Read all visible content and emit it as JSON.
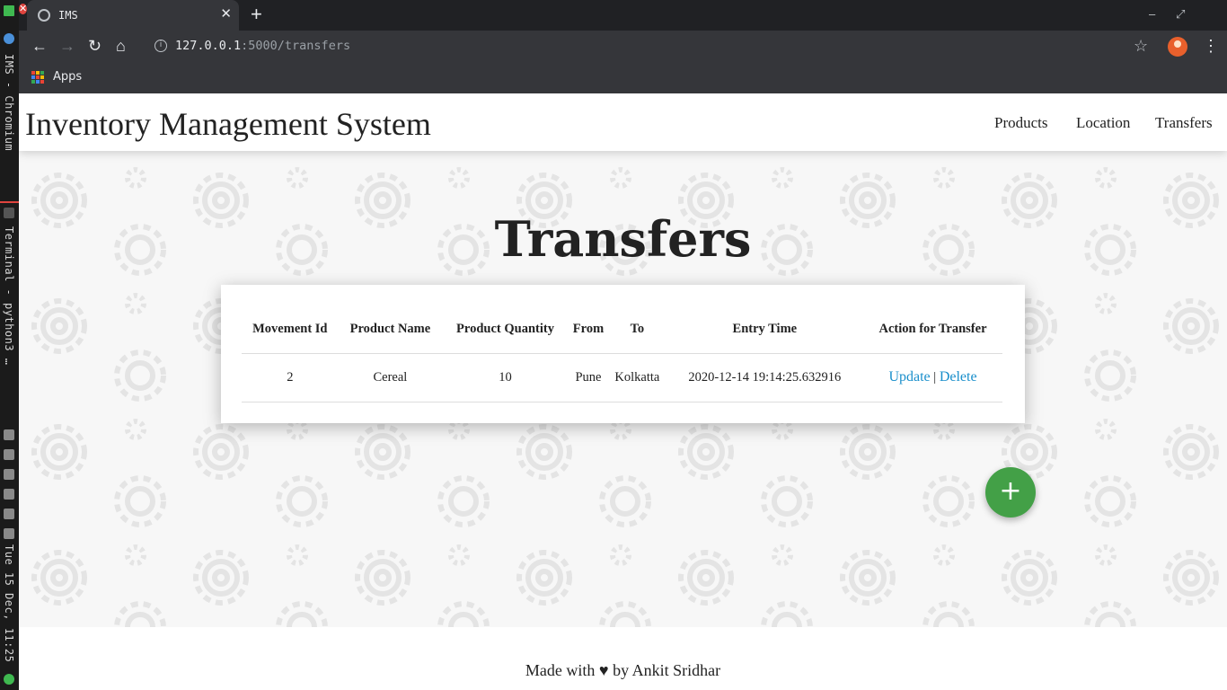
{
  "wm_sidebar": {
    "window_1": "IMS - Chromium",
    "window_2": "Terminal - python3 …",
    "clock": "Tue 15 Dec, 11:25"
  },
  "browser": {
    "tab_title": "IMS",
    "url_host": "127.0.0.1",
    "url_rest": ":5000/transfers",
    "bookmark_apps": "Apps"
  },
  "navbar": {
    "brand": "Inventory Management System",
    "links": [
      "Products",
      "Location",
      "Transfers"
    ]
  },
  "main": {
    "heading": "Transfers",
    "table": {
      "headers": [
        "Movement Id",
        "Product Name",
        "Product Quantity",
        "From",
        "To",
        "Entry Time",
        "Action for Transfer"
      ],
      "rows": [
        {
          "movement_id": "2",
          "product_name": "Cereal",
          "product_quantity": "10",
          "from": "Pune",
          "to": "Kolkatta",
          "entry_time": "2020-12-14 19:14:25.632916",
          "update": "Update",
          "separator": "|",
          "delete": "Delete"
        }
      ]
    },
    "fab_icon": "+"
  },
  "footer": {
    "before": "Made with",
    "heart": "♥",
    "after": "by Ankit Sridhar"
  }
}
